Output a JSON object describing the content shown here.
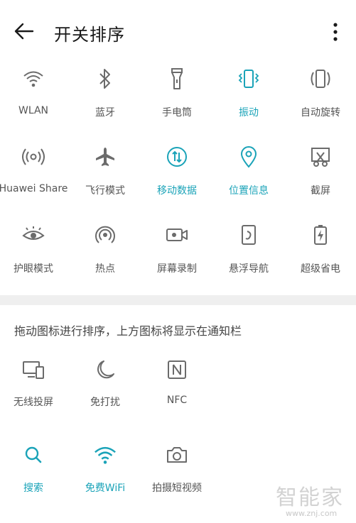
{
  "header": {
    "title": "开关排序"
  },
  "active_tiles": {
    "row1": [
      {
        "label": "WLAN",
        "icon": "wifi-icon",
        "active": false
      },
      {
        "label": "蓝牙",
        "icon": "bluetooth-icon",
        "active": false
      },
      {
        "label": "手电筒",
        "icon": "flashlight-icon",
        "active": false
      },
      {
        "label": "振动",
        "icon": "vibration-icon",
        "active": true
      },
      {
        "label": "自动旋转",
        "icon": "auto-rotate-icon",
        "active": false
      }
    ],
    "row2": [
      {
        "label": "Huawei Share",
        "icon": "huawei-share-icon",
        "active": false
      },
      {
        "label": "飞行模式",
        "icon": "airplane-icon",
        "active": false
      },
      {
        "label": "移动数据",
        "icon": "mobile-data-icon",
        "active": true
      },
      {
        "label": "位置信息",
        "icon": "location-icon",
        "active": true
      },
      {
        "label": "截屏",
        "icon": "screenshot-icon",
        "active": false
      }
    ],
    "row3": [
      {
        "label": "护眼模式",
        "icon": "eye-comfort-icon",
        "active": false
      },
      {
        "label": "热点",
        "icon": "hotspot-icon",
        "active": false
      },
      {
        "label": "屏幕录制",
        "icon": "screen-record-icon",
        "active": false
      },
      {
        "label": "悬浮导航",
        "icon": "floating-nav-icon",
        "active": false
      },
      {
        "label": "超级省电",
        "icon": "power-saving-icon",
        "active": false
      }
    ]
  },
  "hint_text": "拖动图标进行排序，上方图标将显示在通知栏",
  "inactive_tiles": {
    "row1": [
      {
        "label": "无线投屏",
        "icon": "wireless-projection-icon",
        "active": false
      },
      {
        "label": "免打扰",
        "icon": "moon-icon",
        "active": false
      },
      {
        "label": "NFC",
        "icon": "nfc-icon",
        "active": false
      }
    ],
    "row2": [
      {
        "label": "搜索",
        "icon": "search-icon",
        "active": true
      },
      {
        "label": "免费WiFi",
        "icon": "free-wifi-icon",
        "active": true
      },
      {
        "label": "拍摄短视频",
        "icon": "camera-icon",
        "active": false
      }
    ]
  },
  "watermark": {
    "logo": "智能家",
    "url": "www.znj.com"
  },
  "colors": {
    "accent": "#1aa3b8",
    "icon_gray": "#6b6b6b",
    "divider": "#efefef"
  }
}
